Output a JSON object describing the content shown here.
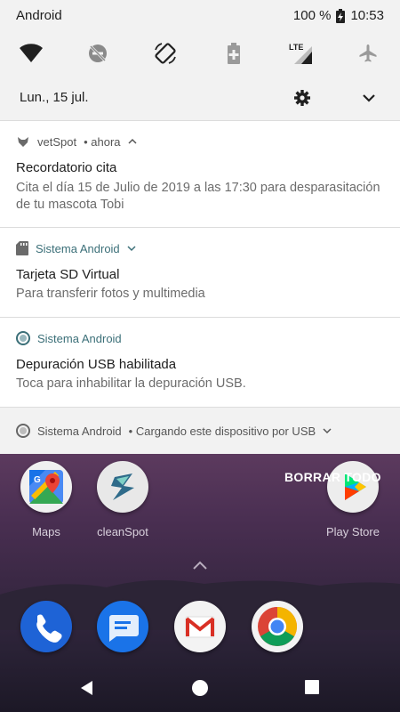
{
  "status_bar": {
    "carrier": "Android",
    "battery": "100 %",
    "time": "10:53"
  },
  "quick_settings": {
    "tiles": [
      "wifi-icon",
      "do-not-disturb-icon",
      "auto-rotate-icon",
      "battery-saver-icon",
      "mobile-data-icon",
      "airplane-mode-icon"
    ],
    "lte_label": "LTE"
  },
  "date": "Lun., 15 jul.",
  "notifications": [
    {
      "app": "vetSpot",
      "meta": "• ahora",
      "title": "Recordatorio cita",
      "text": "Cita el día 15 de Julio de 2019 a las 17:30 para desparasitación de tu mascota Tobi"
    },
    {
      "app": "Sistema Android",
      "title": "Tarjeta SD Virtual",
      "text": "Para transferir fotos y multimedia"
    },
    {
      "app": "Sistema Android",
      "title": "Depuración USB habilitada",
      "text": "Toca para inhabilitar la depuración USB."
    },
    {
      "app": "Sistema Android",
      "meta": "• Cargando este dispositivo por USB"
    }
  ],
  "clear_all": "BORRAR TODO",
  "home_apps": [
    {
      "label": "Maps"
    },
    {
      "label": "cleanSpot"
    },
    {
      "label": "Play Store"
    }
  ],
  "dock_apps": [
    "phone-icon",
    "messages-icon",
    "gmail-icon",
    "chrome-icon"
  ],
  "colors": {
    "accent_teal": "#3b6f78",
    "shade_bg": "#f2f2f2"
  }
}
